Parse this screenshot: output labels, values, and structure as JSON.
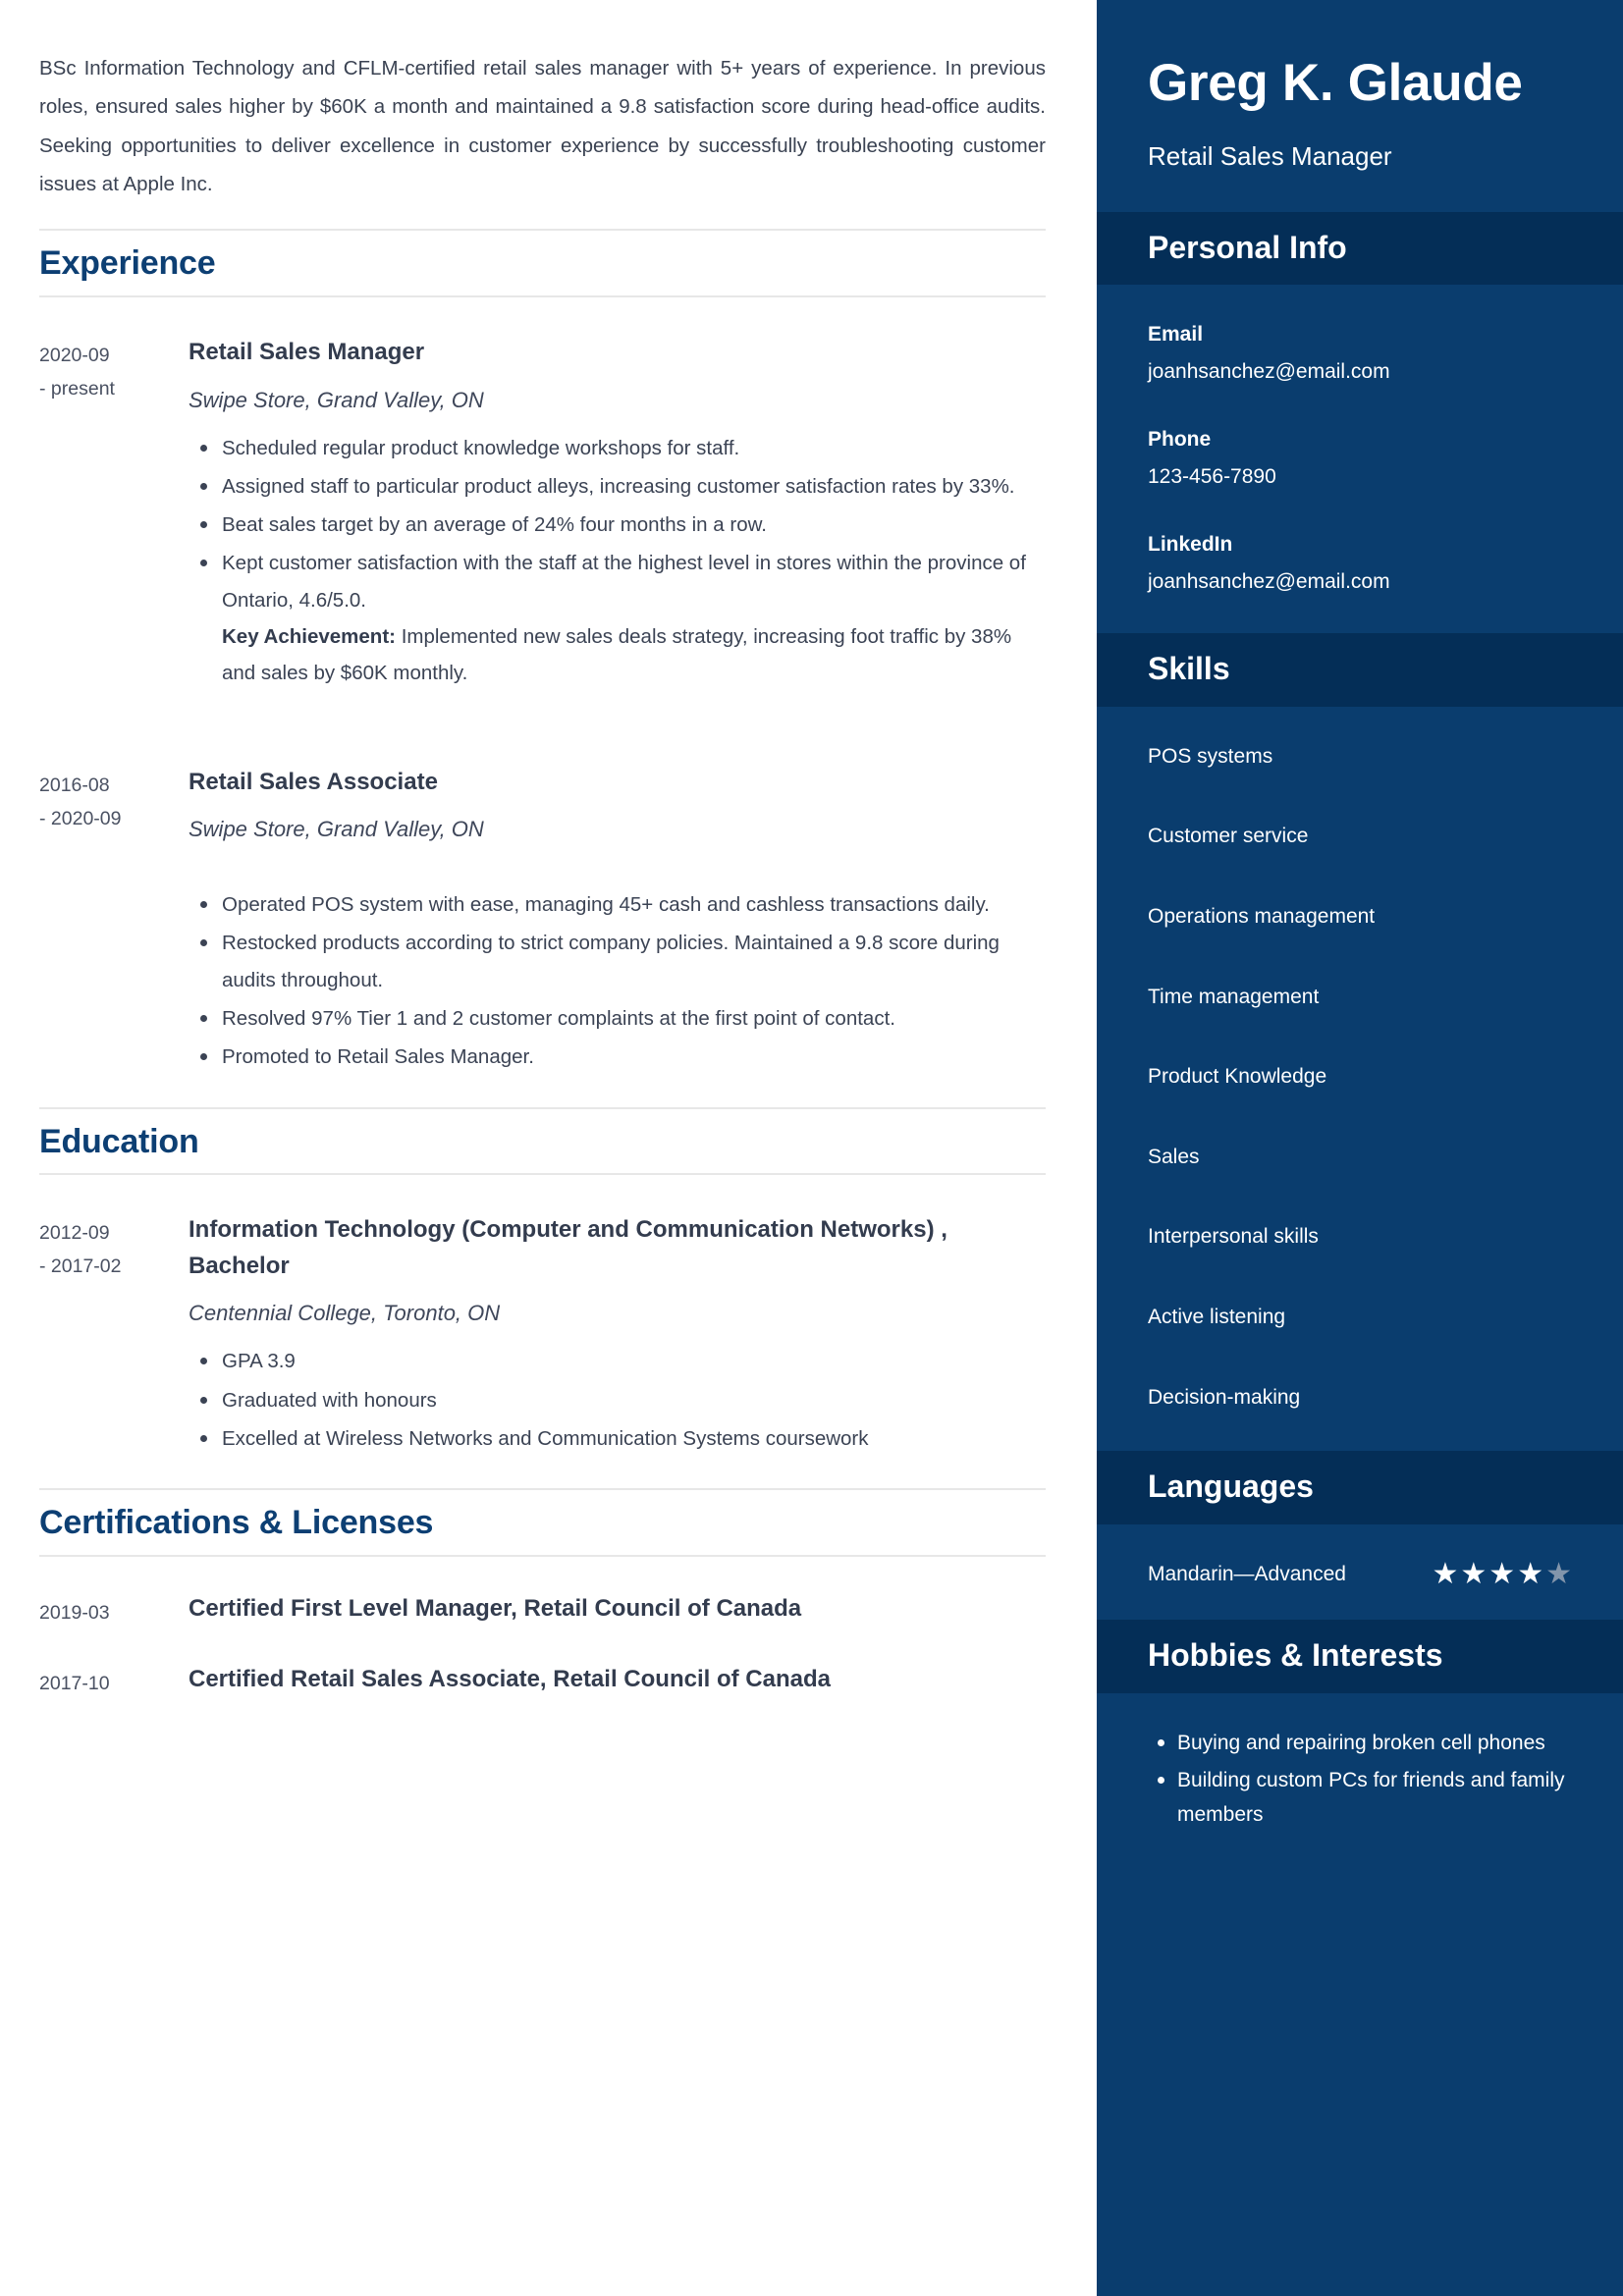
{
  "colors": {
    "sidebar_bg": "#0a3d6e",
    "sidebar_header_bg": "#042e57",
    "heading_blue": "#0d3f73",
    "body_text": "#3b4354",
    "divider": "#e7e7e7",
    "star_on": "#ffffff",
    "star_off": "#8295ab"
  },
  "summary": "BSc Information Technology and CFLM-certified retail sales manager with 5+ years of experience. In previous roles, ensured sales higher by $60K a month and maintained a 9.8 satisfaction score during head-office audits. Seeking opportunities to deliver excellence in customer experience by successfully troubleshooting customer issues at Apple Inc.",
  "sections": {
    "experience": {
      "title": "Experience",
      "entries": [
        {
          "date_start": "2020-09",
          "date_end": "- present",
          "role": "Retail Sales Manager",
          "org": "Swipe Store, Grand Valley, ON",
          "bullets": [
            "Scheduled regular product knowledge workshops for staff.",
            "Assigned staff to particular product alleys, increasing customer satisfaction rates by 33%.",
            "Beat sales target by an average of 24% four months in a row.",
            "Kept customer satisfaction with the staff at the highest level in stores within the province of Ontario, 4.6/5.0."
          ],
          "achievement_label": "Key Achievement:",
          "achievement_text": "Implemented new sales deals strategy, increasing foot traffic by 38% and sales by $60K monthly."
        },
        {
          "date_start": "2016-08",
          "date_end": "- 2020-09",
          "role": "Retail Sales Associate",
          "org": "Swipe Store, Grand Valley, ON",
          "bullets": [
            "Operated POS system with ease, managing 45+ cash and cashless transactions daily.",
            "Restocked products according to strict company policies. Maintained a 9.8 score during audits throughout.",
            "Resolved 97% Tier 1 and 2 customer complaints at the first point of contact.",
            "Promoted to Retail Sales Manager."
          ]
        }
      ]
    },
    "education": {
      "title": "Education",
      "entries": [
        {
          "date_start": "2012-09",
          "date_end": "- 2017-02",
          "degree": "Information Technology (Computer and Communication Networks) , Bachelor",
          "school": "Centennial College, Toronto, ON",
          "bullets": [
            "GPA 3.9",
            "Graduated with honours",
            "Excelled at Wireless Networks and Communication Systems coursework"
          ]
        }
      ]
    },
    "certifications": {
      "title": "Certifications & Licenses",
      "entries": [
        {
          "date": "2019-03",
          "title": "Certified First Level Manager, Retail Council of Canada"
        },
        {
          "date": "2017-10",
          "title": "Certified Retail Sales Associate, Retail Council of Canada"
        }
      ]
    }
  },
  "sidebar": {
    "name": "Greg K. Glaude",
    "job_title": "Retail Sales Manager",
    "personal_info": {
      "title": "Personal Info",
      "items": [
        {
          "label": "Email",
          "value": "joanhsanchez@email.com"
        },
        {
          "label": "Phone",
          "value": "123-456-7890"
        },
        {
          "label": "LinkedIn",
          "value": "joanhsanchez@email.com"
        }
      ]
    },
    "skills": {
      "title": "Skills",
      "items": [
        "POS systems",
        "Customer service",
        "Operations management",
        "Time management",
        "Product Knowledge",
        "Sales",
        "Interpersonal skills",
        "Active listening",
        "Decision-making"
      ]
    },
    "languages": {
      "title": "Languages",
      "items": [
        {
          "name": "Mandarin—Advanced",
          "rating": 4,
          "max_rating": 5
        }
      ]
    },
    "hobbies": {
      "title": "Hobbies & Interests",
      "items": [
        "Buying and repairing broken cell phones",
        "Building custom PCs for friends and family members"
      ]
    }
  }
}
